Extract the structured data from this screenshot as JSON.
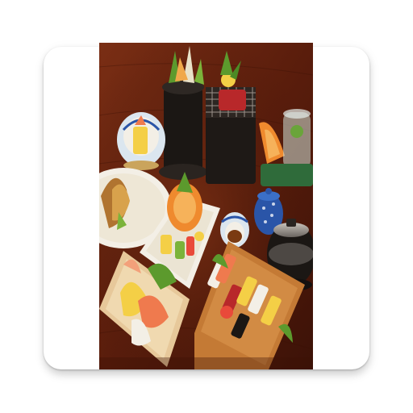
{
  "app_icon": {
    "name": "app-icon",
    "frame_color": "#ffffff",
    "image": {
      "subject": "food-photo",
      "colors": {
        "wood": "#5a1d0c",
        "wood_light": "#7a2e14",
        "plate": "#f3efe6",
        "tray": "#c47a35",
        "salmon": "#ef7a4e",
        "tuna": "#b8282a",
        "egg": "#f4cf46",
        "green": "#5c9a2d",
        "black_pot": "#1b1714",
        "blue_porcelain": "#2a55a8"
      }
    }
  }
}
